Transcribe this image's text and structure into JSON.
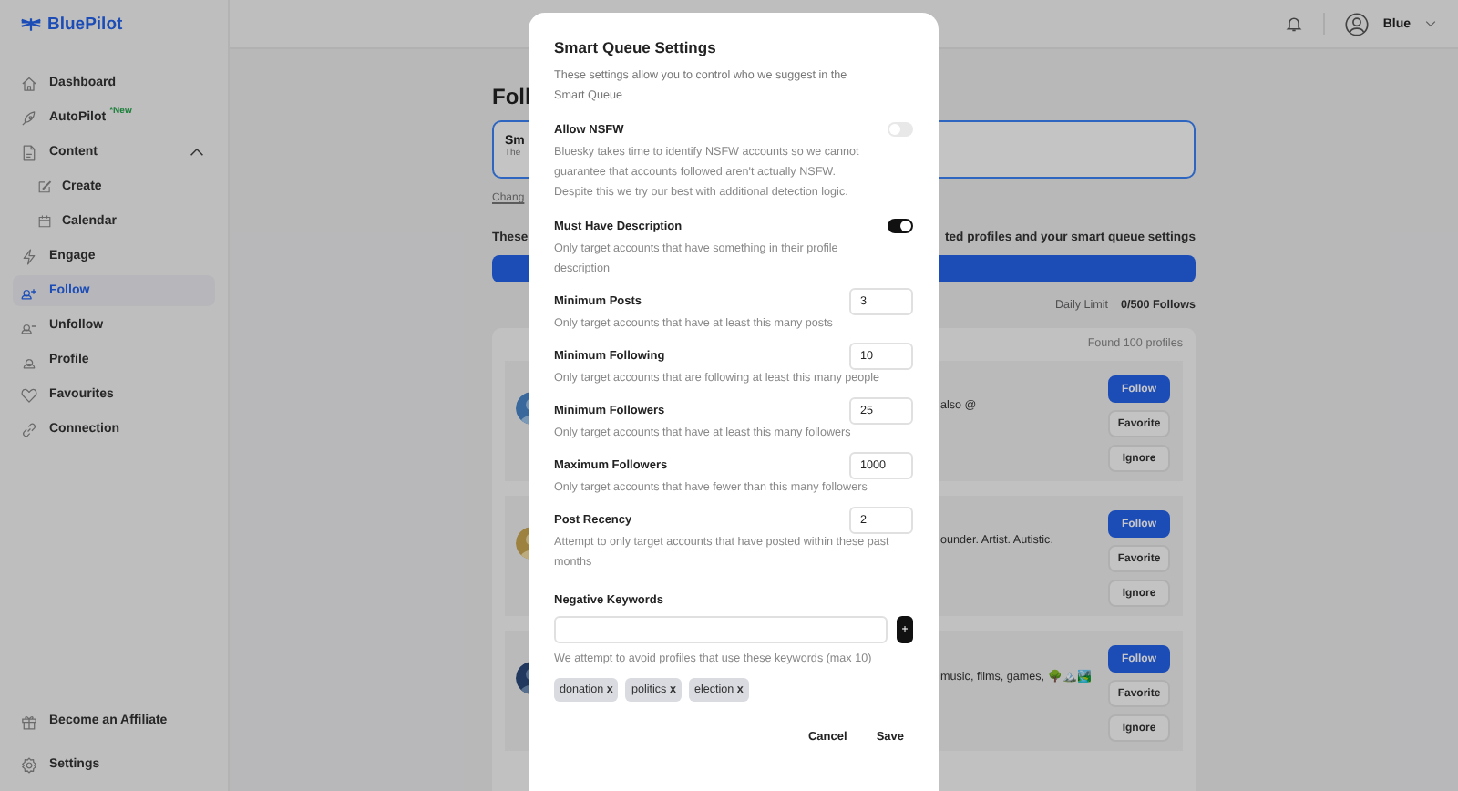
{
  "sidebar": {
    "logo": "BluePilot",
    "items": [
      {
        "label": "Dashboard",
        "selected": false
      },
      {
        "label": "AutoPilot",
        "badge": "*New",
        "selected": false
      },
      {
        "label": "Content",
        "selected": false,
        "expanded": true,
        "children": [
          {
            "label": "Create",
            "selected": false
          },
          {
            "label": "Calendar",
            "selected": false
          }
        ]
      },
      {
        "label": "Engage",
        "selected": false
      },
      {
        "label": "Follow",
        "selected": true
      },
      {
        "label": "Unfollow",
        "selected": false
      },
      {
        "label": "Profile",
        "selected": false
      },
      {
        "label": "Favourites",
        "selected": false
      },
      {
        "label": "Connection",
        "selected": false
      }
    ],
    "bottom_items": [
      {
        "label": "Become an Affiliate"
      },
      {
        "label": "Settings"
      }
    ]
  },
  "top_bar": {
    "user": "Blue"
  },
  "page": {
    "heading_fragment": "Foll",
    "card": {
      "title_fragment": "Sm",
      "text_fragment": "The"
    },
    "link_fragment": "Chang",
    "info_left": "These",
    "info_right": "ted profiles and your smart queue settings",
    "daily_limit_label": "Daily Limit",
    "daily_limit_value": "0/500 Follows",
    "found": "Found 100 profiles",
    "profiles": [
      {
        "text_fragment": "also @",
        "buttons": [
          "Follow",
          "Favorite",
          "Ignore"
        ]
      },
      {
        "text_fragment": "ounder. Artist. Autistic.",
        "buttons": [
          "Follow",
          "Favorite",
          "Ignore"
        ]
      },
      {
        "text_fragment": "music, films, games, 🌳🏔️🏞️",
        "buttons": [
          "Follow",
          "Favorite",
          "Ignore"
        ]
      }
    ]
  },
  "modal": {
    "title": "Smart Queue Settings",
    "description": "These settings allow you to control who we suggest in the Smart Queue",
    "settings": [
      {
        "kind": "toggle",
        "label": "Allow NSFW",
        "description": "Bluesky takes time to identify NSFW accounts so we cannot guarantee that accounts followed aren't actually NSFW. Despite this we try our best with additional detection logic.",
        "on": false
      },
      {
        "kind": "toggle",
        "label": "Must Have Description",
        "description": "Only target accounts that have something in their profile description",
        "on": true
      },
      {
        "kind": "number",
        "label": "Minimum Posts",
        "description": "Only target accounts that have at least this many posts",
        "value": "3"
      },
      {
        "kind": "number",
        "label": "Minimum Following",
        "description": "Only target accounts that are following at least this many people",
        "value": "10"
      },
      {
        "kind": "number",
        "label": "Minimum Followers",
        "description": "Only target accounts that have at least this many followers",
        "value": "25"
      },
      {
        "kind": "number",
        "label": "Maximum Followers",
        "description": "Only target accounts that have fewer than this many followers",
        "value": "1000"
      },
      {
        "kind": "number",
        "label": "Post Recency",
        "description": "Attempt to only target accounts that have posted within these past months",
        "value": "2"
      }
    ],
    "keywords": {
      "label": "Negative Keywords",
      "add_button": "+",
      "hint": "We attempt to avoid profiles that use these keywords (max 10)",
      "tags": [
        {
          "label": "donation",
          "remove": "x"
        },
        {
          "label": "politics",
          "remove": "x"
        },
        {
          "label": "election",
          "remove": "x"
        }
      ]
    },
    "buttons": [
      "Cancel",
      "Save"
    ]
  }
}
